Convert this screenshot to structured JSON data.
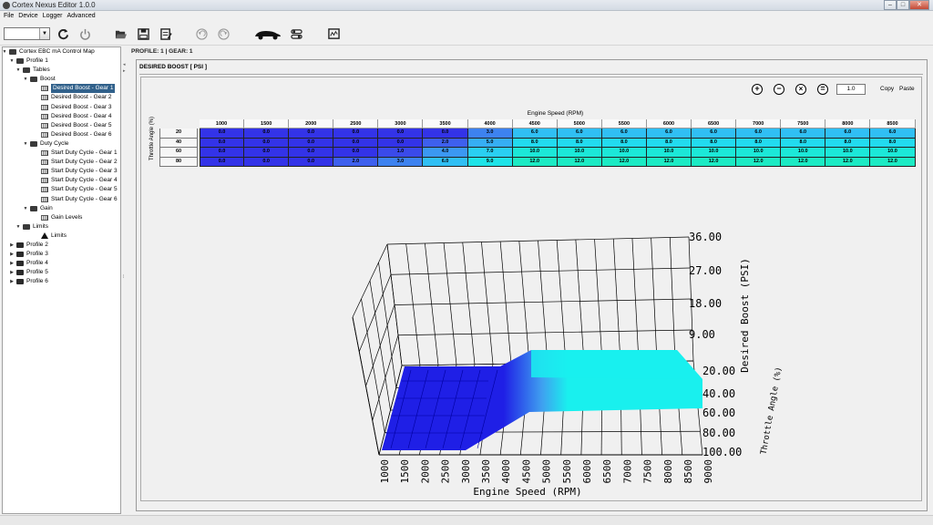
{
  "window": {
    "title": "Cortex Nexus Editor 1.0.0"
  },
  "menu": [
    "File",
    "Device",
    "Logger",
    "Advanced"
  ],
  "toolbar": {
    "combo_value": "",
    "icons": [
      "refresh-icon",
      "power-icon",
      "open-folder-icon",
      "save-icon",
      "save-as-icon",
      "undo-icon",
      "redo-icon",
      "car-icon",
      "toggle-icon",
      "monitor-icon"
    ]
  },
  "tree": [
    {
      "level": 0,
      "label": "Cortex EBC mA Control Map",
      "icon": "folder-open",
      "twisty": "down"
    },
    {
      "level": 1,
      "label": "Profile 1",
      "icon": "folder-open",
      "twisty": "down"
    },
    {
      "level": 2,
      "label": "Tables",
      "icon": "folder-open",
      "twisty": "down"
    },
    {
      "level": 3,
      "label": "Boost",
      "icon": "folder-open",
      "twisty": "down"
    },
    {
      "level": 4,
      "label": "Desired Boost - Gear 1",
      "icon": "grid",
      "selected": true
    },
    {
      "level": 4,
      "label": "Desired Boost - Gear 2",
      "icon": "grid"
    },
    {
      "level": 4,
      "label": "Desired Boost - Gear 3",
      "icon": "grid"
    },
    {
      "level": 4,
      "label": "Desired Boost - Gear 4",
      "icon": "grid"
    },
    {
      "level": 4,
      "label": "Desired Boost - Gear 5",
      "icon": "grid"
    },
    {
      "level": 4,
      "label": "Desired Boost - Gear 6",
      "icon": "grid"
    },
    {
      "level": 3,
      "label": "Duty Cycle",
      "icon": "folder-open",
      "twisty": "down"
    },
    {
      "level": 4,
      "label": "Start Duty Cycle - Gear 1",
      "icon": "grid"
    },
    {
      "level": 4,
      "label": "Start Duty Cycle - Gear 2",
      "icon": "grid"
    },
    {
      "level": 4,
      "label": "Start Duty Cycle - Gear 3",
      "icon": "grid"
    },
    {
      "level": 4,
      "label": "Start Duty Cycle - Gear 4",
      "icon": "grid"
    },
    {
      "level": 4,
      "label": "Start Duty Cycle - Gear 5",
      "icon": "grid"
    },
    {
      "level": 4,
      "label": "Start Duty Cycle - Gear 6",
      "icon": "grid"
    },
    {
      "level": 3,
      "label": "Gain",
      "icon": "folder-open",
      "twisty": "down"
    },
    {
      "level": 4,
      "label": "Gain Levels",
      "icon": "grid"
    },
    {
      "level": 2,
      "label": "Limits",
      "icon": "folder-open",
      "twisty": "down"
    },
    {
      "level": 4,
      "label": "Limits",
      "icon": "warning"
    },
    {
      "level": 1,
      "label": "Profile 2",
      "icon": "folder",
      "twisty": "right"
    },
    {
      "level": 1,
      "label": "Profile 3",
      "icon": "folder",
      "twisty": "right"
    },
    {
      "level": 1,
      "label": "Profile 4",
      "icon": "folder",
      "twisty": "right"
    },
    {
      "level": 1,
      "label": "Profile 5",
      "icon": "folder",
      "twisty": "right"
    },
    {
      "level": 1,
      "label": "Profile 6",
      "icon": "folder",
      "twisty": "right"
    }
  ],
  "main": {
    "profile_header": "PROFILE: 1 | GEAR: 1",
    "panel_title": "DESIRED BOOST [ PSI ]",
    "controls": {
      "factor": "1.0",
      "copy": "Copy",
      "paste": "Paste",
      "icons": [
        "zoom-in-icon",
        "zoom-out-icon",
        "multiply-icon",
        "equals-icon"
      ]
    }
  },
  "table": {
    "x_title": "Engine Speed (RPM)",
    "y_title": "Throttle Angle (%)",
    "cols": [
      "1000",
      "1500",
      "2000",
      "2500",
      "3000",
      "3500",
      "4000",
      "4500",
      "5000",
      "5500",
      "6000",
      "6500",
      "7000",
      "7500",
      "8000",
      "8500"
    ],
    "rows": [
      {
        "label": "20",
        "values": [
          "0.0",
          "0.0",
          "0.0",
          "0.0",
          "0.0",
          "0.0",
          "3.0",
          "6.0",
          "6.0",
          "6.0",
          "6.0",
          "6.0",
          "6.0",
          "6.0",
          "6.0",
          "6.0"
        ]
      },
      {
        "label": "40",
        "values": [
          "0.0",
          "0.0",
          "0.0",
          "0.0",
          "0.0",
          "2.0",
          "5.0",
          "8.0",
          "8.0",
          "8.0",
          "8.0",
          "8.0",
          "8.0",
          "8.0",
          "8.0",
          "8.0"
        ]
      },
      {
        "label": "60",
        "values": [
          "0.0",
          "0.0",
          "0.0",
          "0.0",
          "1.0",
          "4.0",
          "7.0",
          "10.0",
          "10.0",
          "10.0",
          "10.0",
          "10.0",
          "10.0",
          "10.0",
          "10.0",
          "10.0"
        ]
      },
      {
        "label": "80",
        "values": [
          "0.0",
          "0.0",
          "0.0",
          "2.0",
          "3.0",
          "6.0",
          "9.0",
          "12.0",
          "12.0",
          "12.0",
          "12.0",
          "12.0",
          "12.0",
          "12.0",
          "12.0",
          "12.0"
        ]
      }
    ]
  },
  "chart3d": {
    "x_label": "Engine Speed (RPM)",
    "y_label": "Throttle Angle (%)",
    "z_label": "Desired Boost (PSI)",
    "x_ticks": [
      "1000",
      "1500",
      "2000",
      "2500",
      "3000",
      "3500",
      "4000",
      "4500",
      "5000",
      "5500",
      "6000",
      "6500",
      "7000",
      "7500",
      "8000",
      "8500",
      "9000"
    ],
    "y_ticks": [
      "20.00",
      "40.00",
      "60.00",
      "80.00",
      "100.00"
    ],
    "z_ticks": [
      "36.00",
      "27.00",
      "18.00",
      "9.00"
    ],
    "colors": {
      "low": "#1f1fe6",
      "mid": "#3fa0f0",
      "high": "#19f0ee"
    }
  }
}
